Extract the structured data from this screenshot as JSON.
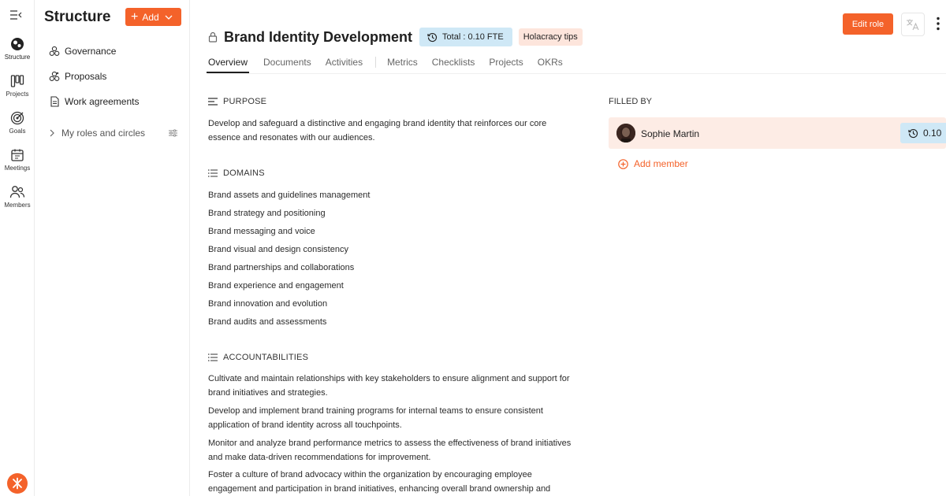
{
  "rail": {
    "items": [
      {
        "label": "Structure",
        "icon": "structure-icon"
      },
      {
        "label": "Projects",
        "icon": "projects-icon"
      },
      {
        "label": "Goals",
        "icon": "goals-icon"
      },
      {
        "label": "Meetings",
        "icon": "meetings-icon"
      },
      {
        "label": "Members",
        "icon": "members-icon"
      }
    ]
  },
  "panel": {
    "title": "Structure",
    "add_label": "Add",
    "nav": [
      {
        "label": "Governance",
        "icon": "governance-icon"
      },
      {
        "label": "Proposals",
        "icon": "proposals-icon"
      },
      {
        "label": "Work agreements",
        "icon": "document-icon"
      }
    ],
    "my_roles_label": "My roles and circles"
  },
  "role": {
    "title": "Brand Identity Development",
    "fte_badge": "Total : 0.10 FTE",
    "tips_label": "Holacracy tips",
    "edit_label": "Edit role"
  },
  "tabs": [
    "Overview",
    "Documents",
    "Activities",
    "Metrics",
    "Checklists",
    "Projects",
    "OKRs"
  ],
  "purpose": {
    "heading": "PURPOSE",
    "text": "Develop and safeguard a distinctive and engaging brand identity that reinforces our core essence and resonates with our audiences."
  },
  "domains": {
    "heading": "DOMAINS",
    "items": [
      "Brand assets and guidelines management",
      "Brand strategy and positioning",
      "Brand messaging and voice",
      "Brand visual and design consistency",
      "Brand partnerships and collaborations",
      "Brand experience and engagement",
      "Brand innovation and evolution",
      "Brand audits and assessments"
    ]
  },
  "accountabilities": {
    "heading": "ACCOUNTABILITIES",
    "items": [
      "Cultivate and maintain relationships with key stakeholders to ensure alignment and support for brand initiatives and strategies.",
      "Develop and implement brand training programs for internal teams to ensure consistent application of brand identity across all touchpoints.",
      "Monitor and analyze brand performance metrics to assess the effectiveness of brand initiatives and make data-driven recommendations for improvement.",
      "Foster a culture of brand advocacy within the organization by encouraging employee engagement and participation in brand initiatives, enhancing overall brand ownership and"
    ]
  },
  "filled_by": {
    "heading": "FILLED BY",
    "member_name": "Sophie Martin",
    "member_fte": "0.10",
    "add_member_label": "Add member"
  },
  "colors": {
    "accent": "#f4622a",
    "fte_badge_bg": "#cfe8f6",
    "tips_badge_bg": "#fde5dc",
    "member_row_bg": "#fdece5"
  }
}
